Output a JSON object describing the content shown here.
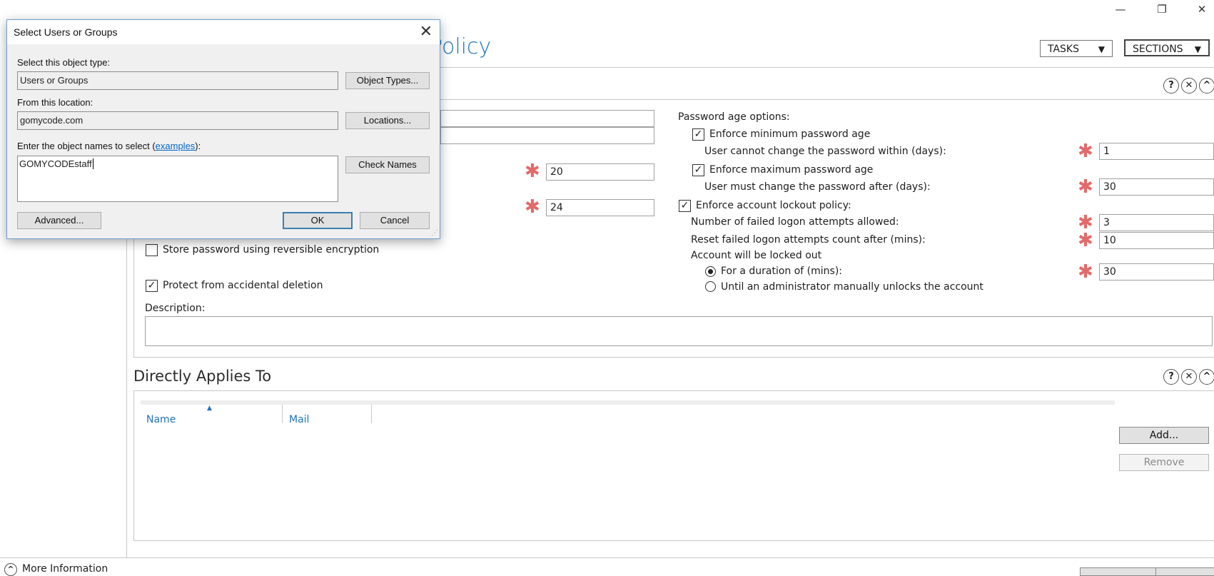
{
  "window_controls": {
    "minimize": "—",
    "restore": "❐",
    "close": "✕"
  },
  "page": {
    "title_fragment": "Policy"
  },
  "header": {
    "tasks_label": "TASKS",
    "sections_label": "SECTIONS",
    "dropdown_glyph": "▼"
  },
  "panel_controls": {
    "help": "?",
    "close": "✕",
    "collapse": "^"
  },
  "password_settings": {
    "left_values": {
      "value_a": "20",
      "value_b": "24"
    },
    "store_reversible": {
      "label": "Store password using reversible encryption",
      "checked": false
    },
    "protect_deletion": {
      "label": "Protect from accidental deletion",
      "checked": true
    },
    "description_label": "Description:",
    "age_options_label": "Password age options:",
    "enforce_min": {
      "label": "Enforce minimum password age",
      "checked": true
    },
    "min_days_label": "User cannot change the password within (days):",
    "min_days_value": "1",
    "enforce_max": {
      "label": "Enforce maximum password age",
      "checked": true
    },
    "max_days_label": "User must change the password after (days):",
    "max_days_value": "30",
    "lockout": {
      "label": "Enforce account lockout policy:",
      "checked": true
    },
    "failed_attempts_label": "Number of failed logon attempts allowed:",
    "failed_attempts_value": "3",
    "reset_label": "Reset failed logon attempts count after (mins):",
    "reset_value": "10",
    "locked_out_label": "Account will be locked out",
    "duration_option": {
      "label": "For a duration of (mins):",
      "selected": true
    },
    "duration_value": "30",
    "admin_unlock_option": {
      "label": "Until an administrator manually unlocks the account",
      "selected": false
    },
    "required_glyph": "✱",
    "check_glyph": "✓"
  },
  "directly_applies": {
    "title": "Directly Applies To",
    "columns": [
      "Name",
      "Mail"
    ],
    "sort_glyph": "▲",
    "add_label": "Add...",
    "remove_label": "Remove"
  },
  "footer": {
    "more_info": "More Information",
    "expand_glyph": "^"
  },
  "dialog": {
    "title": "Select Users or Groups",
    "close_glyph": "✕",
    "object_type_label": "Select this object type:",
    "object_type_value": "Users or Groups",
    "object_types_button": "Object Types...",
    "location_label": "From this location:",
    "location_value": "gomycode.com",
    "locations_button": "Locations...",
    "names_label_prefix": "Enter the object names to select (",
    "names_label_link": "examples",
    "names_label_suffix": "):",
    "names_value": "GOMYCODEstaff",
    "check_names_button": "Check Names",
    "advanced_button": "Advanced...",
    "ok_button": "OK",
    "cancel_button": "Cancel",
    "grip_glyph": "⋰"
  }
}
